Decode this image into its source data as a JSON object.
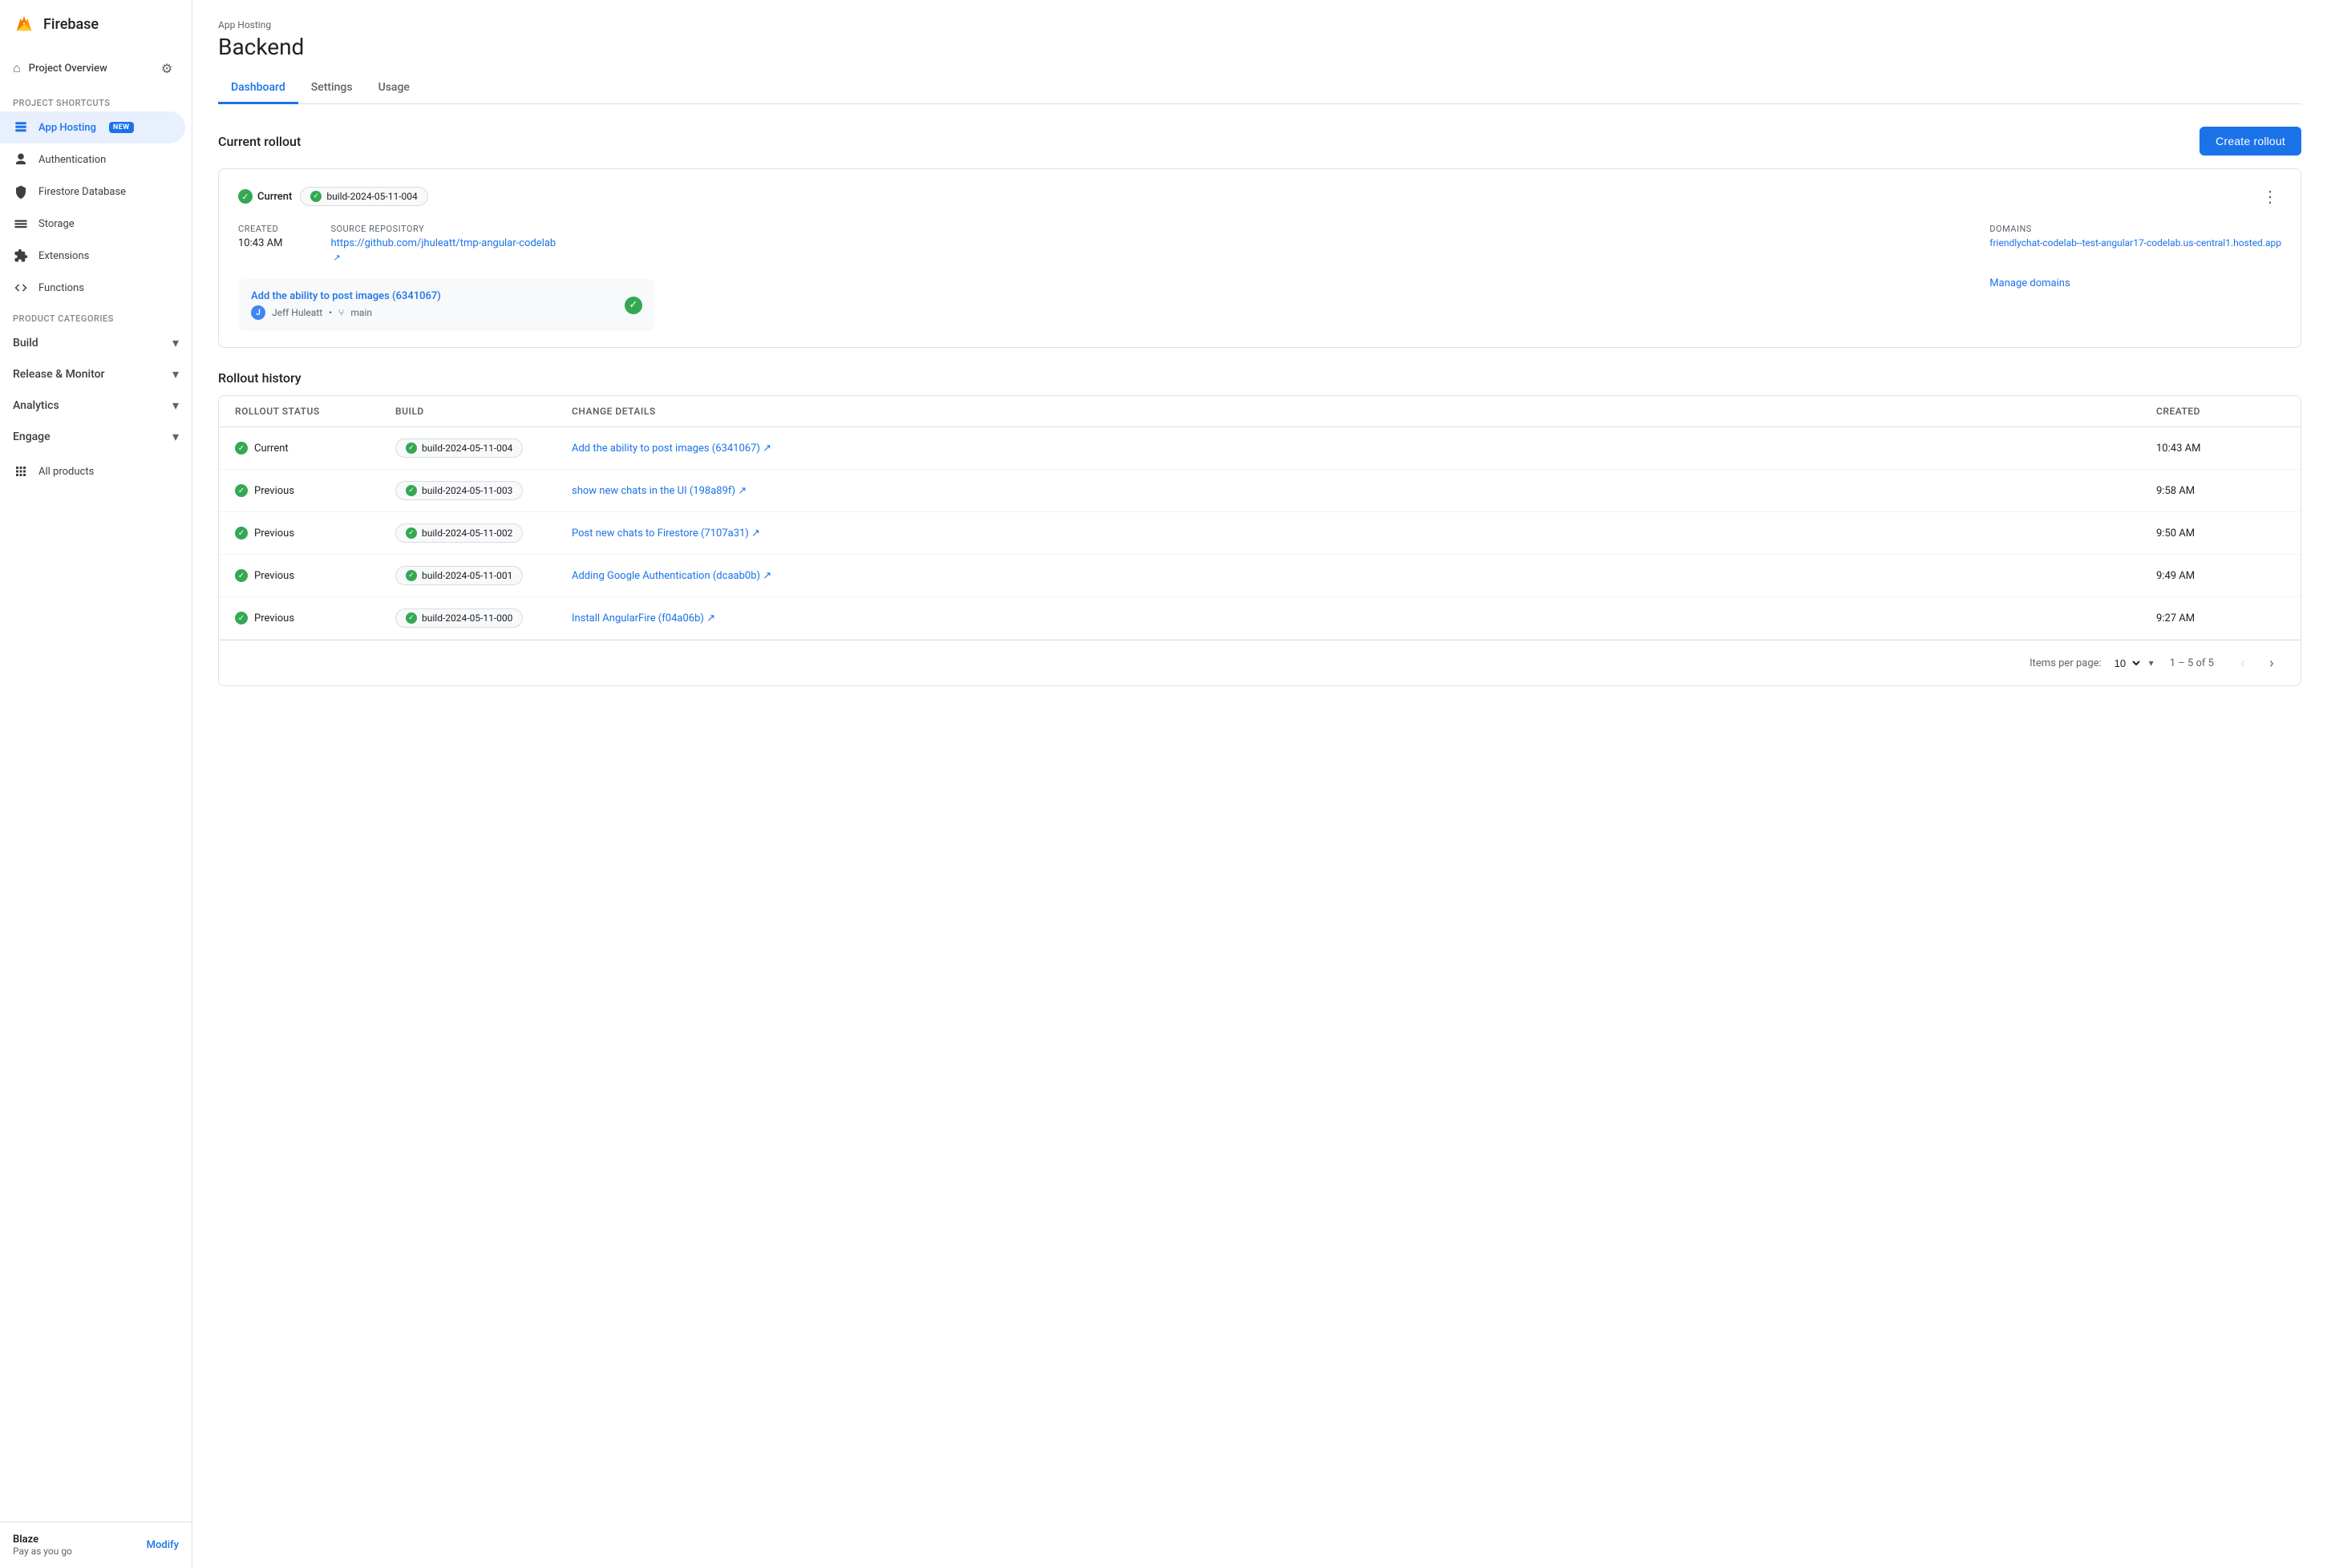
{
  "sidebar": {
    "app_name": "Firebase",
    "project_overview": "Project Overview",
    "project_shortcuts_label": "Project shortcuts",
    "nav_items": [
      {
        "id": "app-hosting",
        "label": "App Hosting",
        "badge": "NEW",
        "active": true
      },
      {
        "id": "authentication",
        "label": "Authentication",
        "active": false
      },
      {
        "id": "firestore",
        "label": "Firestore Database",
        "active": false
      },
      {
        "id": "storage",
        "label": "Storage",
        "active": false
      },
      {
        "id": "extensions",
        "label": "Extensions",
        "active": false
      },
      {
        "id": "functions",
        "label": "Functions",
        "active": false
      }
    ],
    "product_categories_label": "Product categories",
    "categories": [
      {
        "id": "build",
        "label": "Build"
      },
      {
        "id": "release-monitor",
        "label": "Release & Monitor"
      },
      {
        "id": "analytics",
        "label": "Analytics"
      },
      {
        "id": "engage",
        "label": "Engage"
      }
    ],
    "all_products": "All products",
    "footer": {
      "plan_name": "Blaze",
      "plan_sub": "Pay as you go",
      "modify_label": "Modify"
    }
  },
  "header": {
    "breadcrumb": "App Hosting",
    "title": "Backend"
  },
  "tabs": [
    {
      "id": "dashboard",
      "label": "Dashboard",
      "active": true
    },
    {
      "id": "settings",
      "label": "Settings",
      "active": false
    },
    {
      "id": "usage",
      "label": "Usage",
      "active": false
    }
  ],
  "current_rollout": {
    "section_title": "Current rollout",
    "create_button": "Create rollout",
    "status": "Current",
    "build_tag": "build-2024-05-11-004",
    "created_label": "Created",
    "created_value": "10:43 AM",
    "source_repo_label": "Source repository",
    "source_repo_url": "https://github.com/jhuleatt/tmp-angular-codelab",
    "domains_label": "Domains",
    "domain_url": "friendlychat-codelab--test-angular17-codelab.us-central1.hosted.app",
    "commit_link_text": "Add the ability to post images (6341067)",
    "commit_author": "Jeff Huleatt",
    "commit_branch": "main",
    "manage_domains": "Manage domains"
  },
  "rollout_history": {
    "section_title": "Rollout history",
    "columns": [
      "Rollout Status",
      "Build",
      "Change details",
      "Created"
    ],
    "rows": [
      {
        "status": "Current",
        "build": "build-2024-05-11-004",
        "change": "Add the ability to post images (6341067)",
        "created": "10:43 AM"
      },
      {
        "status": "Previous",
        "build": "build-2024-05-11-003",
        "change": "show new chats in the UI (198a89f)",
        "created": "9:58 AM"
      },
      {
        "status": "Previous",
        "build": "build-2024-05-11-002",
        "change": "Post new chats to Firestore (7107a31)",
        "created": "9:50 AM"
      },
      {
        "status": "Previous",
        "build": "build-2024-05-11-001",
        "change": "Adding Google Authentication (dcaab0b)",
        "created": "9:49 AM"
      },
      {
        "status": "Previous",
        "build": "build-2024-05-11-000",
        "change": "Install AngularFire (f04a06b)",
        "created": "9:27 AM"
      }
    ],
    "items_per_page_label": "Items per page:",
    "items_per_page_value": "10",
    "page_info": "1 – 5 of 5"
  }
}
